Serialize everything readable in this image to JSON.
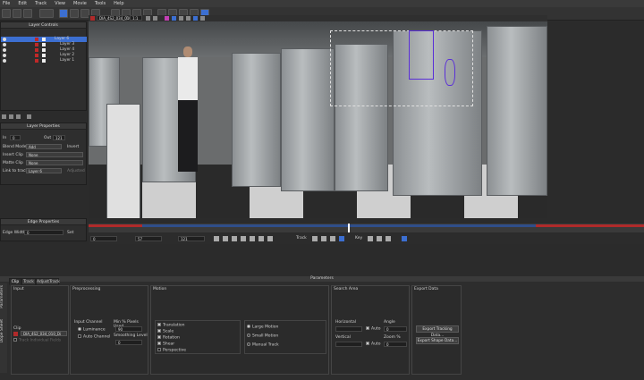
{
  "menu": [
    "File",
    "Edit",
    "Track",
    "View",
    "Movie",
    "Tools",
    "Help"
  ],
  "layer_controls": {
    "title": "Layer Controls",
    "layers": [
      "Layer 6",
      "Layer 3",
      "Layer 4",
      "Layer 2",
      "Layer 1"
    ],
    "selected_index": 0
  },
  "layer_properties": {
    "title": "Layer Properties",
    "in_label": "In",
    "in_value": "0",
    "out_label": "Out",
    "out_value": "121",
    "blend_mode_label": "Blend Mode",
    "blend_mode_value": "Add",
    "invert_label": "Invert",
    "insert_clip_label": "Insert Clip",
    "insert_clip_value": "None",
    "matte_clip_label": "Matte Clip",
    "matte_clip_value": "None",
    "link_label": "Link to track",
    "link_value": "Layer 6",
    "adjusted_label": "Adjusted"
  },
  "edge_properties": {
    "title": "Edge Properties",
    "edge_width_label": "Edge Width",
    "edge_width_value": "0",
    "set_label": "Set"
  },
  "toolbar_fields": {
    "clip_name": "DIA_4S2_034_010_Div",
    "zoom": "1:1"
  },
  "playback": {
    "start_frame": "0",
    "current_frame": "57",
    "end_frame": "121",
    "track_label": "Track",
    "key_label": "Key"
  },
  "params": {
    "title": "Parameters",
    "tabs": [
      "Clip",
      "Track",
      "AdjustTrack"
    ],
    "side_tabs": [
      "Parameters",
      "Dope Sheet"
    ],
    "input": {
      "title": "Input",
      "clip_label": "Clip",
      "clip_value": "DIA_4S2_034_010_Di",
      "track_individual": "Track Individual Fields"
    },
    "preprocessing": {
      "title": "Preprocessing",
      "input_channel_label": "Input Channel",
      "luminance": "Luminance",
      "auto_channel": "Auto Channel",
      "min_pixels_label": "Min % Pixels Used",
      "min_pixels_value": "90",
      "smoothing_label": "Smoothing Level",
      "smoothing_value": "0"
    },
    "motion": {
      "title": "Motion",
      "checks": [
        {
          "label": "Translation",
          "on": true
        },
        {
          "label": "Scale",
          "on": true
        },
        {
          "label": "Rotation",
          "on": true
        },
        {
          "label": "Shear",
          "on": true
        },
        {
          "label": "Perspective",
          "on": false
        }
      ],
      "radios": [
        {
          "label": "Large Motion",
          "on": true
        },
        {
          "label": "Small Motion",
          "on": false
        },
        {
          "label": "Manual Track",
          "on": false
        }
      ]
    },
    "search_area": {
      "title": "Search Area",
      "horizontal_label": "Horizontal",
      "vertical_label": "Vertical",
      "auto_label": "Auto",
      "angle_label": "Angle",
      "angle_value": "0",
      "zoom_label": "Zoom %",
      "zoom_value": "0"
    },
    "export": {
      "title": "Export Data",
      "tracking_button": "Export Tracking Data...",
      "shape_button": "Export Shape Data..."
    }
  },
  "colors": {
    "accent_blue": "#3c6fd1",
    "timeline_red": "#b02a2a",
    "spline_purple": "#5a2fd8"
  }
}
